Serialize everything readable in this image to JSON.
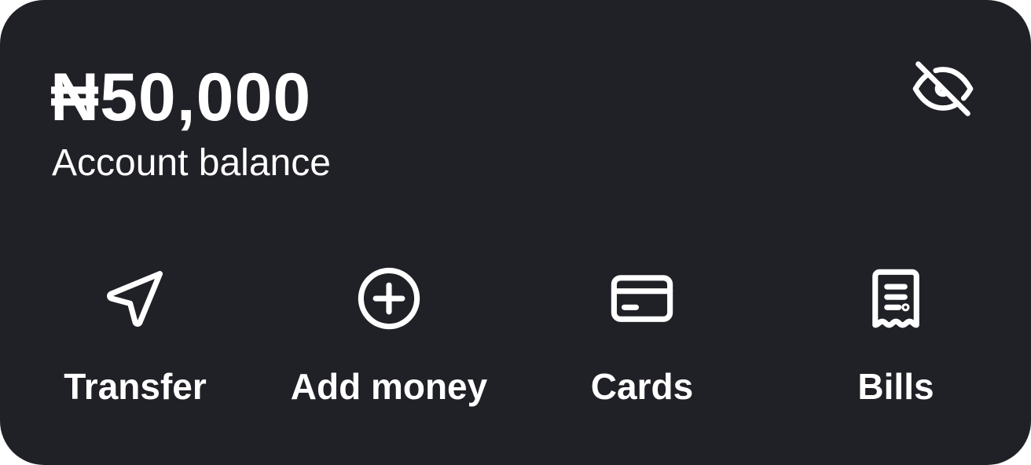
{
  "balance": {
    "amount": "₦50,000",
    "label": "Account balance"
  },
  "visibility_toggle": {
    "icon": "eye-off-icon"
  },
  "actions": [
    {
      "label": "Transfer",
      "icon": "send-icon"
    },
    {
      "label": "Add money",
      "icon": "plus-circle-icon"
    },
    {
      "label": "Cards",
      "icon": "credit-card-icon"
    },
    {
      "label": "Bills",
      "icon": "receipt-icon"
    }
  ],
  "colors": {
    "card_background": "#202027",
    "text": "#ffffff"
  }
}
